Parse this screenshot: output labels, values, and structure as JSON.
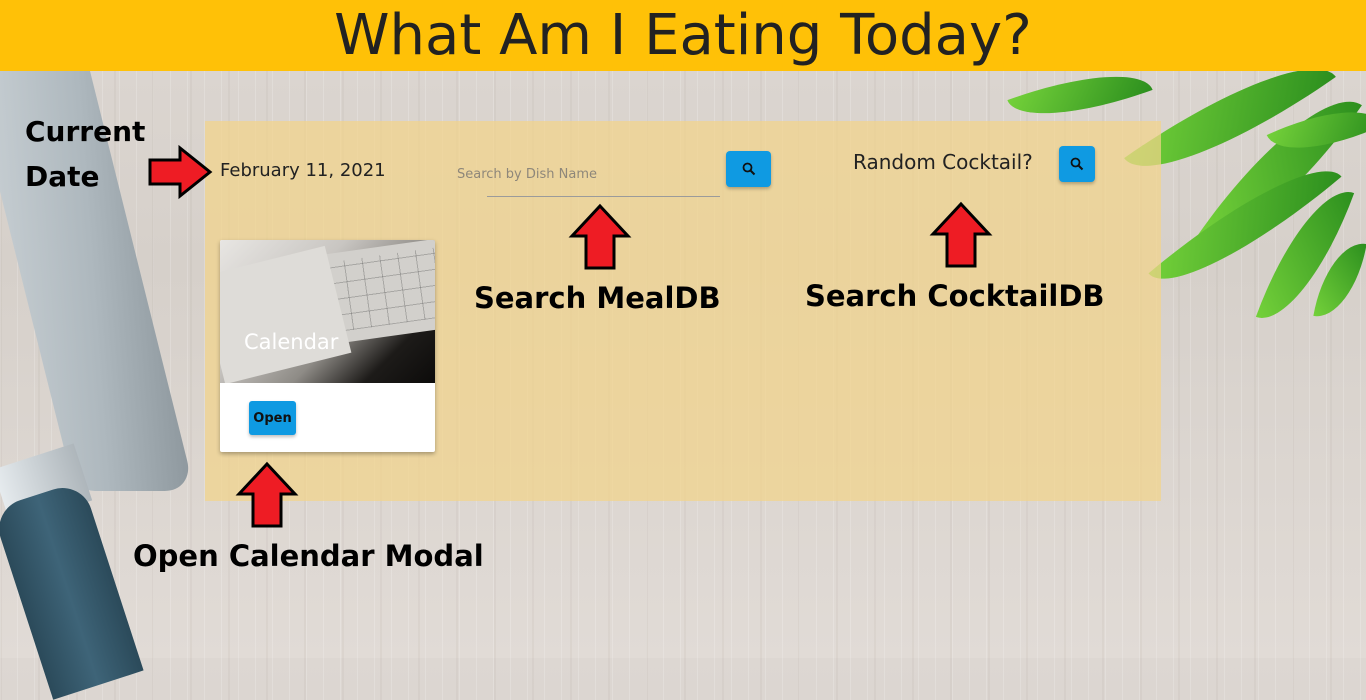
{
  "header": {
    "title": "What Am I Eating Today?"
  },
  "main": {
    "current_date": "February 11, 2021",
    "meal_search": {
      "placeholder": "Search by Dish Name",
      "value": ""
    },
    "cocktail": {
      "label": "Random Cocktail?"
    },
    "calendar_card": {
      "title": "Calendar",
      "open_label": "Open"
    }
  },
  "annotations": {
    "current_date": [
      "Current",
      "Date"
    ],
    "search_mealdb": "Search MealDB",
    "search_cocktaildb": "Search CocktailDB",
    "open_calendar_modal": "Open Calendar Modal"
  },
  "icons": {
    "meal_search_button": "search-icon",
    "cocktail_button": "search-icon",
    "arrow": "red-arrow-icon"
  },
  "colors": {
    "header_bg": "#ffc107",
    "button": "#0f9ae2",
    "arrow_fill": "#ee1c24",
    "panel": "#f2d48a"
  }
}
